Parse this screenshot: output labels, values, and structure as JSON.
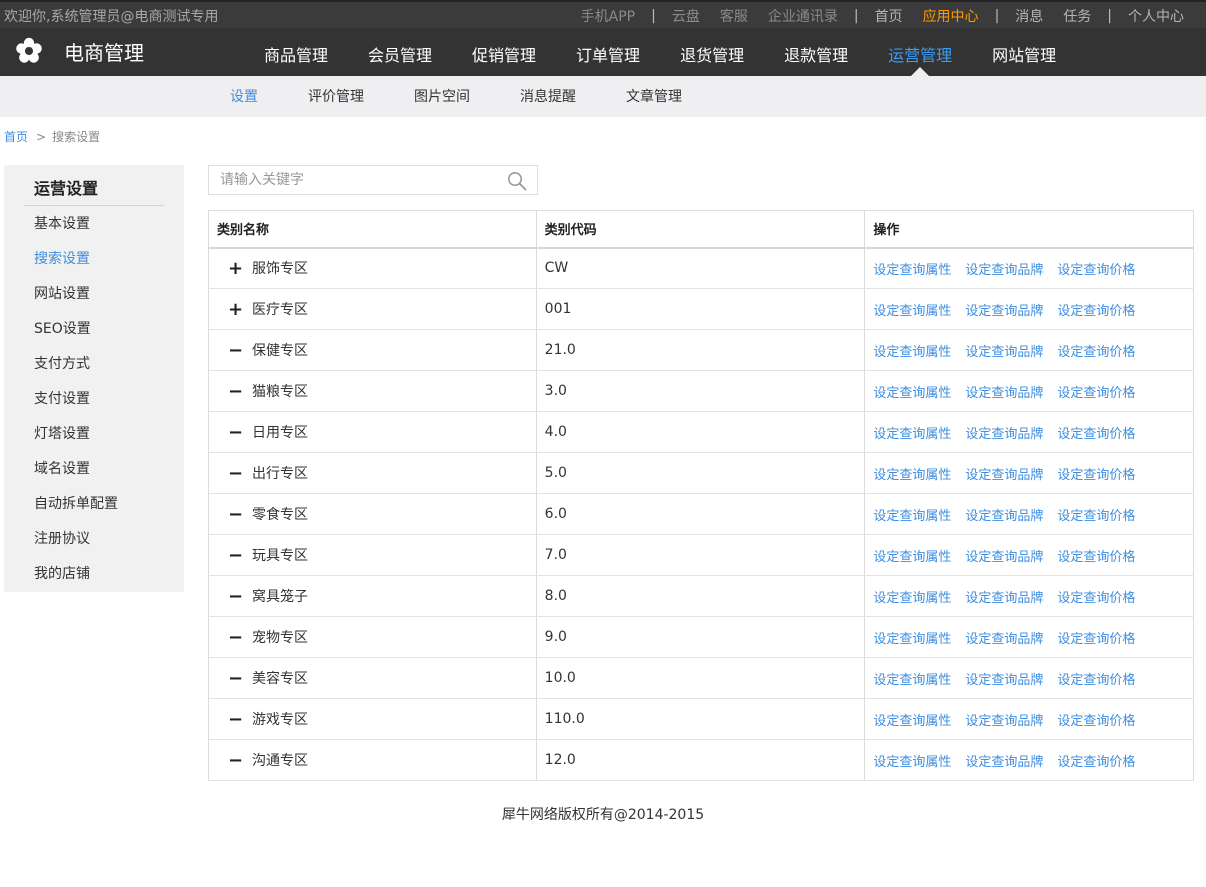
{
  "topbar": {
    "welcome": "欢迎你,系统管理员@电商测试专用",
    "links": [
      {
        "label": "手机APP",
        "style": "dim"
      },
      {
        "sep": true
      },
      {
        "label": "云盘",
        "style": "dim"
      },
      {
        "label": "客服",
        "style": "dim"
      },
      {
        "label": "企业通讯录",
        "style": "dim"
      },
      {
        "sep": true
      },
      {
        "label": "首页",
        "style": "light"
      },
      {
        "label": "应用中心",
        "style": "highlight"
      },
      {
        "sep": true
      },
      {
        "label": "消息",
        "style": "light"
      },
      {
        "label": "任务",
        "style": "light"
      },
      {
        "sep": true
      },
      {
        "label": "个人中心",
        "style": "light"
      }
    ]
  },
  "logo": {
    "text": "电商管理"
  },
  "mainnav": [
    {
      "label": "商品管理",
      "active": false
    },
    {
      "label": "会员管理",
      "active": false
    },
    {
      "label": "促销管理",
      "active": false
    },
    {
      "label": "订单管理",
      "active": false
    },
    {
      "label": "退货管理",
      "active": false
    },
    {
      "label": "退款管理",
      "active": false
    },
    {
      "label": "运营管理",
      "active": true
    },
    {
      "label": "网站管理",
      "active": false
    }
  ],
  "subnav": [
    {
      "label": "设置",
      "active": true
    },
    {
      "label": "评价管理",
      "active": false
    },
    {
      "label": "图片空间",
      "active": false
    },
    {
      "label": "消息提醒",
      "active": false
    },
    {
      "label": "文章管理",
      "active": false
    }
  ],
  "breadcrumb": {
    "home": "首页",
    "arrow": ">",
    "current": "搜索设置"
  },
  "sidebar": {
    "title": "运营设置",
    "items": [
      {
        "label": "基本设置",
        "active": false
      },
      {
        "label": "搜索设置",
        "active": true
      },
      {
        "label": "网站设置",
        "active": false
      },
      {
        "label": "SEO设置",
        "active": false
      },
      {
        "label": "支付方式",
        "active": false
      },
      {
        "label": "支付设置",
        "active": false
      },
      {
        "label": "灯塔设置",
        "active": false
      },
      {
        "label": "域名设置",
        "active": false
      },
      {
        "label": "自动拆单配置",
        "active": false
      },
      {
        "label": "注册协议",
        "active": false
      },
      {
        "label": "我的店铺",
        "active": false
      }
    ]
  },
  "search": {
    "placeholder": "请输入关键字",
    "value": ""
  },
  "table": {
    "headers": [
      "类别名称",
      "类别代码",
      "操作"
    ],
    "actions": [
      "设定查询属性",
      "设定查询品牌",
      "设定查询价格"
    ],
    "rows": [
      {
        "toggle": "+",
        "name": "服饰专区",
        "code": "CW"
      },
      {
        "toggle": "+",
        "name": "医疗专区",
        "code": "001"
      },
      {
        "toggle": "−",
        "name": "保健专区",
        "code": "21.0"
      },
      {
        "toggle": "−",
        "name": "猫粮专区",
        "code": "3.0"
      },
      {
        "toggle": "−",
        "name": "日用专区",
        "code": "4.0"
      },
      {
        "toggle": "−",
        "name": "出行专区",
        "code": "5.0"
      },
      {
        "toggle": "−",
        "name": "零食专区",
        "code": "6.0"
      },
      {
        "toggle": "−",
        "name": "玩具专区",
        "code": "7.0"
      },
      {
        "toggle": "−",
        "name": "窝具笼子",
        "code": "8.0"
      },
      {
        "toggle": "−",
        "name": "宠物专区",
        "code": "9.0"
      },
      {
        "toggle": "−",
        "name": "美容专区",
        "code": "10.0"
      },
      {
        "toggle": "−",
        "name": "游戏专区",
        "code": "110.0"
      },
      {
        "toggle": "−",
        "name": "沟通专区",
        "code": "12.0"
      }
    ]
  },
  "footer": {
    "text": "犀牛网络版权所有@2014-2015"
  },
  "colors": {
    "accent": "#3d8ee0",
    "highlight": "#ff9900",
    "navbar": "#333333",
    "subnav": "#efeff1"
  }
}
